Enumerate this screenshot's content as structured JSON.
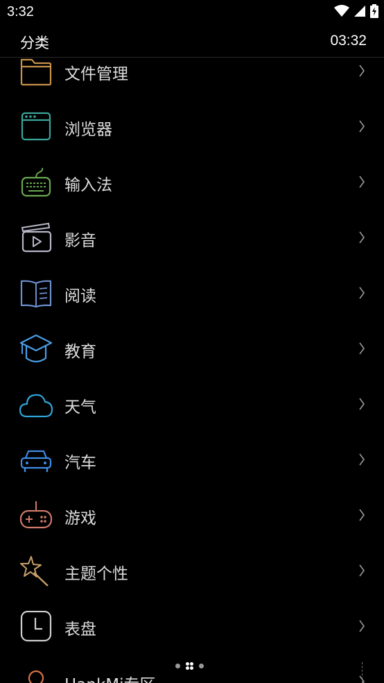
{
  "status_bar": {
    "time": "3:32",
    "icons": [
      "wifi-icon",
      "signal-icon",
      "battery-charging-icon"
    ]
  },
  "header": {
    "title": "分类",
    "clock": "03:32"
  },
  "categories": [
    {
      "label": "文件管理",
      "icon": "folder-icon",
      "color": "#c9924a"
    },
    {
      "label": "浏览器",
      "icon": "browser-window-icon",
      "color": "#3aa69a"
    },
    {
      "label": "输入法",
      "icon": "keyboard-icon",
      "color": "#6aa84f"
    },
    {
      "label": "影音",
      "icon": "video-clapper-icon",
      "color": "#b7b7c9"
    },
    {
      "label": "阅读",
      "icon": "open-book-icon",
      "color": "#6d8fd0"
    },
    {
      "label": "教育",
      "icon": "graduation-cap-icon",
      "color": "#4a9ee8"
    },
    {
      "label": "天气",
      "icon": "cloud-icon",
      "color": "#2fa4d8"
    },
    {
      "label": "汽车",
      "icon": "car-icon",
      "color": "#3f8be8"
    },
    {
      "label": "游戏",
      "icon": "gamepad-icon",
      "color": "#d07a6a"
    },
    {
      "label": "主题个性",
      "icon": "magic-wand-star-icon",
      "color": "#c8a06a"
    },
    {
      "label": "表盘",
      "icon": "clock-face-icon",
      "color": "#cfcfcf"
    },
    {
      "label": "HankMi专区",
      "icon": "person-icon",
      "color": "#d9744a"
    }
  ],
  "pager": {
    "pages": 3,
    "active": 1
  },
  "chevron": "›"
}
